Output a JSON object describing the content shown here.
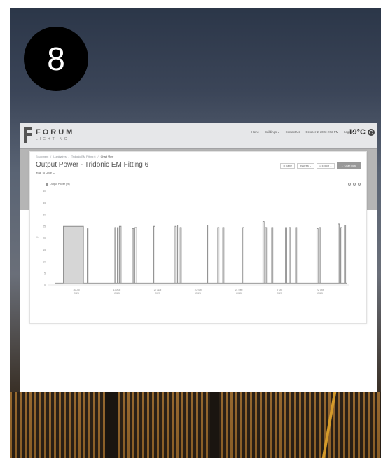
{
  "step_number": "8",
  "app": {
    "logo_title": "FORUM",
    "logo_subtitle": "LIGHTING",
    "nav": [
      "Home",
      "Buildings ⌄",
      "Contact Us",
      "October 2, 2023 2:53 PM",
      "Logout"
    ],
    "temperature": "19°C"
  },
  "breadcrumb": [
    "Equipment",
    "/",
    "Luminaires",
    "/",
    "Tridonic EM Fitting 6",
    "/",
    "Chart View"
  ],
  "page_title": "Output Power - Tridonic EM Fitting 6",
  "range_select": "Year to Date ⌄",
  "toolbar": {
    "table_label": "☰ Table",
    "by_area_label": "By Area ⌄",
    "export_label": "⇩ Export ⌄",
    "primary_label": "← Chart Data"
  },
  "chart_data": {
    "type": "line",
    "series": [
      {
        "name": "Output Power (%)"
      }
    ],
    "ylabel": "%",
    "ylim": [
      0,
      40
    ],
    "yticks": [
      "0",
      "5",
      "10",
      "15",
      "20",
      "25",
      "30",
      "35",
      "40"
    ],
    "xticks": [
      "30 Jul\n2023",
      "13 Aug\n2023",
      "27 Aug\n2023",
      "10 Sep\n2023",
      "24 Sep\n2023",
      "8 Oct\n2023",
      "22 Oct\n2023"
    ],
    "colors": {
      "line": "#8a8a8a",
      "fill": "#d6d6d6"
    },
    "pulses": [
      {
        "x0": 0.06,
        "x1": 0.14,
        "y": 25.0,
        "filled": true
      },
      {
        "x0": 0.155,
        "x1": 0.158,
        "y": 24.0
      },
      {
        "x0": 0.265,
        "x1": 0.268,
        "y": 24.5
      },
      {
        "x0": 0.275,
        "x1": 0.278,
        "y": 24.5
      },
      {
        "x0": 0.283,
        "x1": 0.29,
        "y": 25.0
      },
      {
        "x0": 0.335,
        "x1": 0.34,
        "y": 24.0
      },
      {
        "x0": 0.345,
        "x1": 0.352,
        "y": 24.5
      },
      {
        "x0": 0.42,
        "x1": 0.425,
        "y": 25.0
      },
      {
        "x0": 0.505,
        "x1": 0.51,
        "y": 25.0
      },
      {
        "x0": 0.515,
        "x1": 0.52,
        "y": 25.5
      },
      {
        "x0": 0.525,
        "x1": 0.53,
        "y": 24.5
      },
      {
        "x0": 0.635,
        "x1": 0.64,
        "y": 25.5
      },
      {
        "x0": 0.675,
        "x1": 0.68,
        "y": 24.5
      },
      {
        "x0": 0.695,
        "x1": 0.7,
        "y": 24.5
      },
      {
        "x0": 0.775,
        "x1": 0.78,
        "y": 24.5
      },
      {
        "x0": 0.855,
        "x1": 0.86,
        "y": 27.0
      },
      {
        "x0": 0.865,
        "x1": 0.87,
        "y": 24.5
      },
      {
        "x0": 0.89,
        "x1": 0.895,
        "y": 24.5
      },
      {
        "x0": 0.945,
        "x1": 0.95,
        "y": 24.5
      },
      {
        "x0": 0.96,
        "x1": 0.965,
        "y": 24.5
      },
      {
        "x0": 0.985,
        "x1": 0.99,
        "y": 24.5
      },
      {
        "x0": 1.07,
        "x1": 1.075,
        "y": 24.0
      },
      {
        "x0": 1.08,
        "x1": 1.085,
        "y": 24.5
      },
      {
        "x0": 1.155,
        "x1": 1.16,
        "y": 26.0
      },
      {
        "x0": 1.165,
        "x1": 1.17,
        "y": 24.5
      },
      {
        "x0": 1.18,
        "x1": 1.185,
        "y": 25.5
      }
    ]
  }
}
